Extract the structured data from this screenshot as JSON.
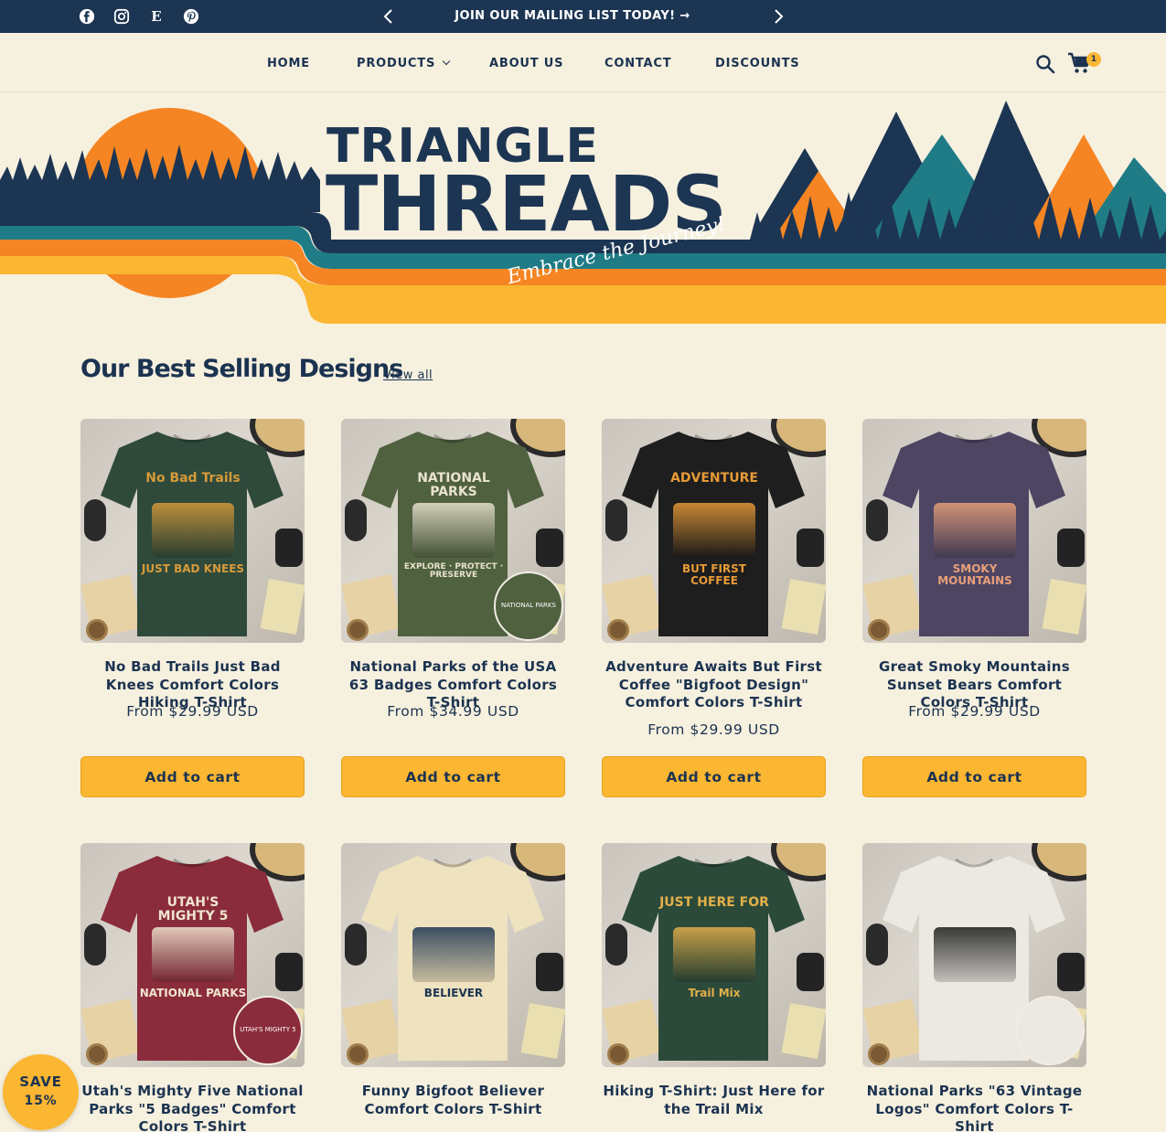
{
  "announcement": {
    "text": "JOIN OUR MAILING LIST TODAY! →"
  },
  "social_icons": [
    "facebook-icon",
    "instagram-icon",
    "etsy-icon",
    "pinterest-icon"
  ],
  "etsy_glyph": "E",
  "nav": {
    "home": "HOME",
    "products": "PRODUCTS",
    "about": "ABOUT US",
    "contact": "CONTACT",
    "discounts": "DISCOUNTS",
    "cart_count": "1"
  },
  "banner": {
    "brand_line1": "TRIANGLE",
    "brand_line2": "THREADS",
    "tagline": "Embrace the Journey!"
  },
  "colors": {
    "navy": "#1c3553",
    "teal": "#1f7b86",
    "orange": "#f58523",
    "gold": "#fbb632",
    "cream": "#f6f0df"
  },
  "section": {
    "title": "Our Best Selling Designs",
    "view_all": "View all"
  },
  "products": [
    {
      "title": "No Bad Trails Just Bad Knees Comfort Colors Hiking T-Shirt",
      "price": "From $29.99 USD",
      "button": "Add to cart",
      "shirt_color": "#2f4a3b",
      "print_top": "No Bad Trails",
      "print_bottom": "JUST BAD KNEES"
    },
    {
      "title": "National Parks of the USA 63 Badges Comfort Colors T-Shirt",
      "price": "From $34.99 USD",
      "button": "Add to cart",
      "shirt_color": "#50613f",
      "print_top": "NATIONAL PARKS",
      "print_bottom": "EXPLORE · PROTECT · PRESERVE",
      "inset_text": "NATIONAL PARKS"
    },
    {
      "title": "Adventure Awaits But First Coffee \"Bigfoot Design\" Comfort Colors T-Shirt",
      "price": "From $29.99 USD",
      "button": "Add to cart",
      "shirt_color": "#1e1e1f",
      "print_top": "ADVENTURE",
      "print_bottom": "BUT FIRST COFFEE"
    },
    {
      "title": "Great Smoky Mountains Sunset Bears Comfort Colors T-Shirt",
      "price": "From $29.99 USD",
      "button": "Add to cart",
      "shirt_color": "#4e4563",
      "print_top": "",
      "print_bottom": "SMOKY MOUNTAINS"
    },
    {
      "title": "Utah's Mighty Five National Parks \"5 Badges\" Comfort Colors T-Shirt",
      "price": "",
      "button": "",
      "shirt_color": "#8a2c3b",
      "print_top": "UTAH'S MIGHTY 5",
      "print_bottom": "NATIONAL PARKS",
      "inset_text": "UTAH'S MIGHTY 5"
    },
    {
      "title": "Funny Bigfoot Believer Comfort Colors T-Shirt",
      "price": "",
      "button": "",
      "shirt_color": "#efe2bf",
      "print_top": "",
      "print_bottom": "BELIEVER"
    },
    {
      "title": "Hiking T-Shirt: Just Here for the Trail Mix",
      "price": "",
      "button": "",
      "shirt_color": "#2c4a3a",
      "print_top": "JUST HERE FOR",
      "print_bottom": "Trail Mix"
    },
    {
      "title": "National Parks \"63 Vintage Logos\" Comfort Colors T-Shirt",
      "price": "",
      "button": "",
      "shirt_color": "#ece9e2",
      "print_top": "",
      "print_bottom": "",
      "inset_text": ""
    }
  ],
  "save_badge": {
    "line1": "SAVE",
    "line2": "15%"
  }
}
